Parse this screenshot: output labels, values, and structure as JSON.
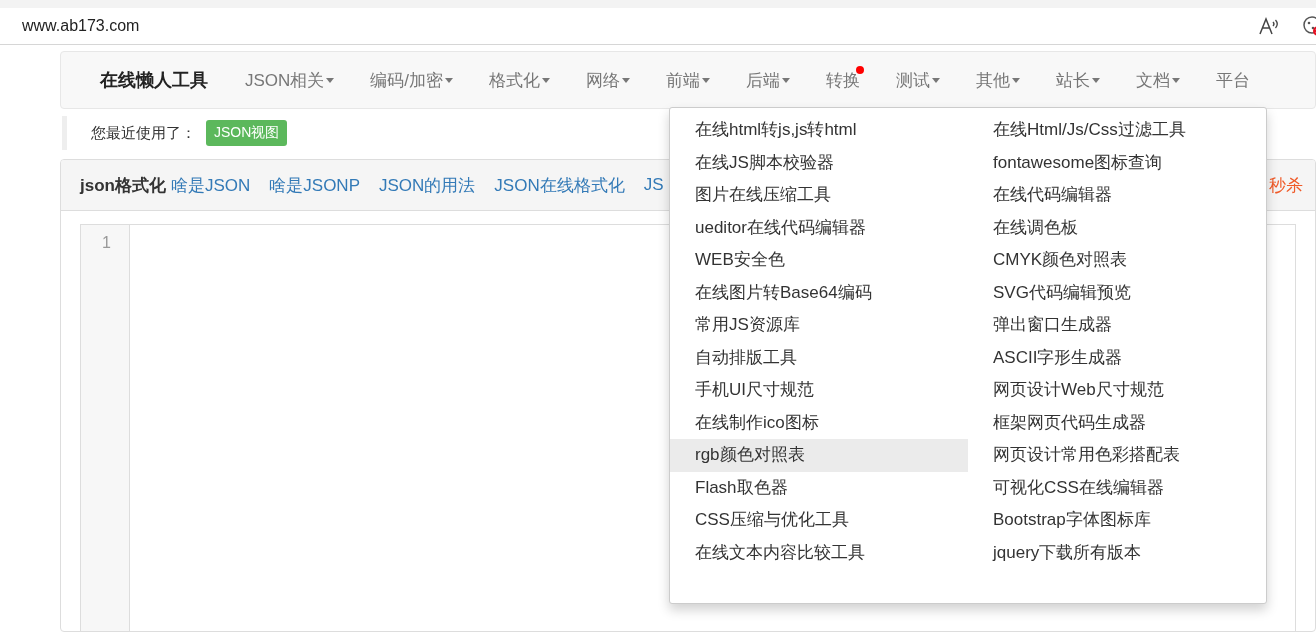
{
  "browser": {
    "address": "www.ab173.com"
  },
  "navbar": {
    "brand": "在线懒人工具",
    "items": [
      {
        "label": "JSON相关",
        "caret": true,
        "dot": false
      },
      {
        "label": "编码/加密",
        "caret": true,
        "dot": false
      },
      {
        "label": "格式化",
        "caret": true,
        "dot": false
      },
      {
        "label": "网络",
        "caret": true,
        "dot": false
      },
      {
        "label": "前端",
        "caret": true,
        "dot": false
      },
      {
        "label": "后端",
        "caret": true,
        "dot": false
      },
      {
        "label": "转换",
        "caret": false,
        "dot": true
      },
      {
        "label": "测试",
        "caret": true,
        "dot": false
      },
      {
        "label": "其他",
        "caret": true,
        "dot": false
      },
      {
        "label": "站长",
        "caret": true,
        "dot": false
      },
      {
        "label": "文档",
        "caret": true,
        "dot": false
      },
      {
        "label": "平台",
        "caret": false,
        "dot": false
      }
    ]
  },
  "recent": {
    "label": "您最近使用了：",
    "tags": [
      "JSON视图"
    ]
  },
  "panel": {
    "title": "json格式化",
    "links": [
      "啥是JSON",
      "啥是JSONP",
      "JSON的用法",
      "JSON在线格式化",
      "JS"
    ],
    "promo": "秒杀",
    "line_numbers": [
      "1"
    ]
  },
  "dropdown": {
    "columns": [
      {
        "items": [
          {
            "label": "在线html转js,js转html",
            "hovered": false
          },
          {
            "label": "在线JS脚本校验器",
            "hovered": false
          },
          {
            "label": "图片在线压缩工具",
            "hovered": false
          },
          {
            "label": "ueditor在线代码编辑器",
            "hovered": false
          },
          {
            "label": "WEB安全色",
            "hovered": false
          },
          {
            "label": "在线图片转Base64编码",
            "hovered": false
          },
          {
            "label": "常用JS资源库",
            "hovered": false
          },
          {
            "label": "自动排版工具",
            "hovered": false
          },
          {
            "label": "手机UI尺寸规范",
            "hovered": false
          },
          {
            "label": "在线制作ico图标",
            "hovered": false
          },
          {
            "label": "rgb颜色对照表",
            "hovered": true
          },
          {
            "label": "Flash取色器",
            "hovered": false
          },
          {
            "label": "CSS压缩与优化工具",
            "hovered": false
          },
          {
            "label": "在线文本内容比较工具",
            "hovered": false
          }
        ]
      },
      {
        "items": [
          {
            "label": "在线Html/Js/Css过滤工具",
            "hovered": false
          },
          {
            "label": "fontawesome图标查询",
            "hovered": false
          },
          {
            "label": "在线代码编辑器",
            "hovered": false
          },
          {
            "label": "在线调色板",
            "hovered": false
          },
          {
            "label": "CMYK颜色对照表",
            "hovered": false
          },
          {
            "label": "SVG代码编辑预览",
            "hovered": false
          },
          {
            "label": "弹出窗口生成器",
            "hovered": false
          },
          {
            "label": "ASCII字形生成器",
            "hovered": false
          },
          {
            "label": "网页设计Web尺寸规范",
            "hovered": false
          },
          {
            "label": "框架网页代码生成器",
            "hovered": false
          },
          {
            "label": "网页设计常用色彩搭配表",
            "hovered": false
          },
          {
            "label": "可视化CSS在线编辑器",
            "hovered": false
          },
          {
            "label": "Bootstrap字体图标库",
            "hovered": false
          },
          {
            "label": "jquery下载所有版本",
            "hovered": false
          }
        ]
      }
    ]
  }
}
